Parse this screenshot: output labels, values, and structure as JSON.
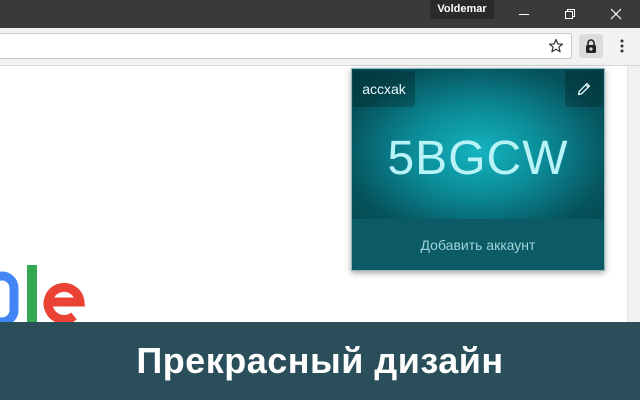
{
  "titlebar": {
    "profile_name": "Voldemar"
  },
  "icons": {
    "minimize": "minimize-icon",
    "maximize": "restore-icon",
    "close": "close-icon",
    "bookmark": "star-icon",
    "extension": "lock-icon",
    "menu": "kebab-menu-icon",
    "edit": "pencil-icon"
  },
  "popup": {
    "account_name": "accxak",
    "code": "5BGCW",
    "add_account_label": "Добавить аккаунт"
  },
  "banner": {
    "text": "Прекрасный дизайн"
  },
  "colors": {
    "popup_accent": "#0b8a96",
    "banner_bg": "#2b4f5a",
    "code_text": "#b8f3f7"
  }
}
